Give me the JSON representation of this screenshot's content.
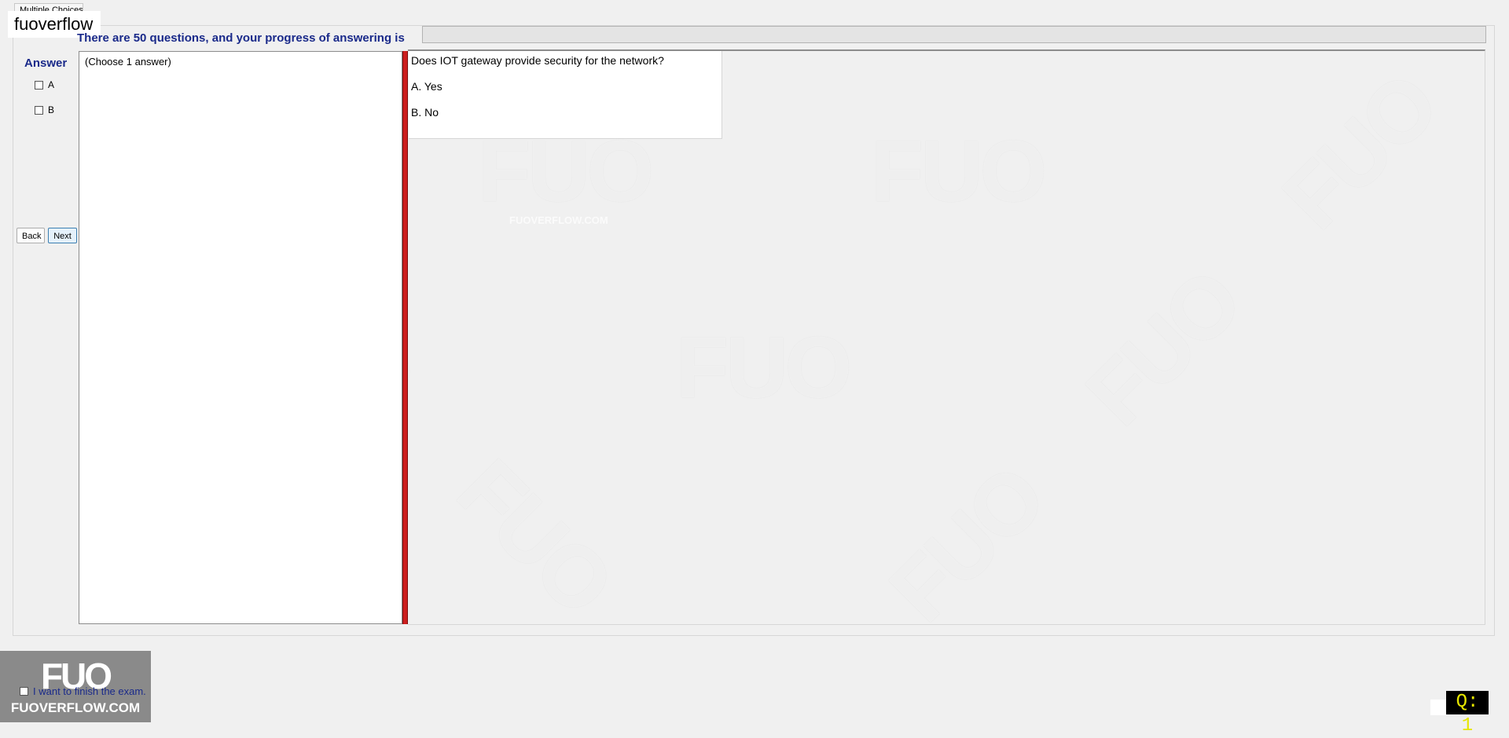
{
  "window": {
    "tab_label": "Multiple Choices",
    "site_label": "fuoverflow"
  },
  "progress": {
    "text": "There are 50 questions, and your progress of answering is",
    "value": 0
  },
  "answer_panel": {
    "heading": "Answer",
    "options": [
      {
        "label": "A"
      },
      {
        "label": "B"
      }
    ]
  },
  "nav": {
    "back_label": "Back",
    "next_label": "Next"
  },
  "left_panel": {
    "instruction": "(Choose 1 answer)"
  },
  "question": {
    "text": "Does IOT gateway provide security for the network?",
    "options": [
      "A.  Yes",
      "B.  No"
    ]
  },
  "watermark": {
    "mark": "FUO",
    "site": "FUOVERFLOW.COM"
  },
  "footer": {
    "logo_text": "FUO",
    "logo_site": "FUOVERFLOW.COM",
    "finish_label": "I want to finish the exam.",
    "question_counter": "Q: 1"
  },
  "colors": {
    "heading_blue": "#1a2a8a",
    "splitter_red": "#cc1f1f",
    "counter_bg": "#000000",
    "counter_fg": "#e6e600"
  },
  "icons": {
    "checkbox": "checkbox-icon"
  }
}
